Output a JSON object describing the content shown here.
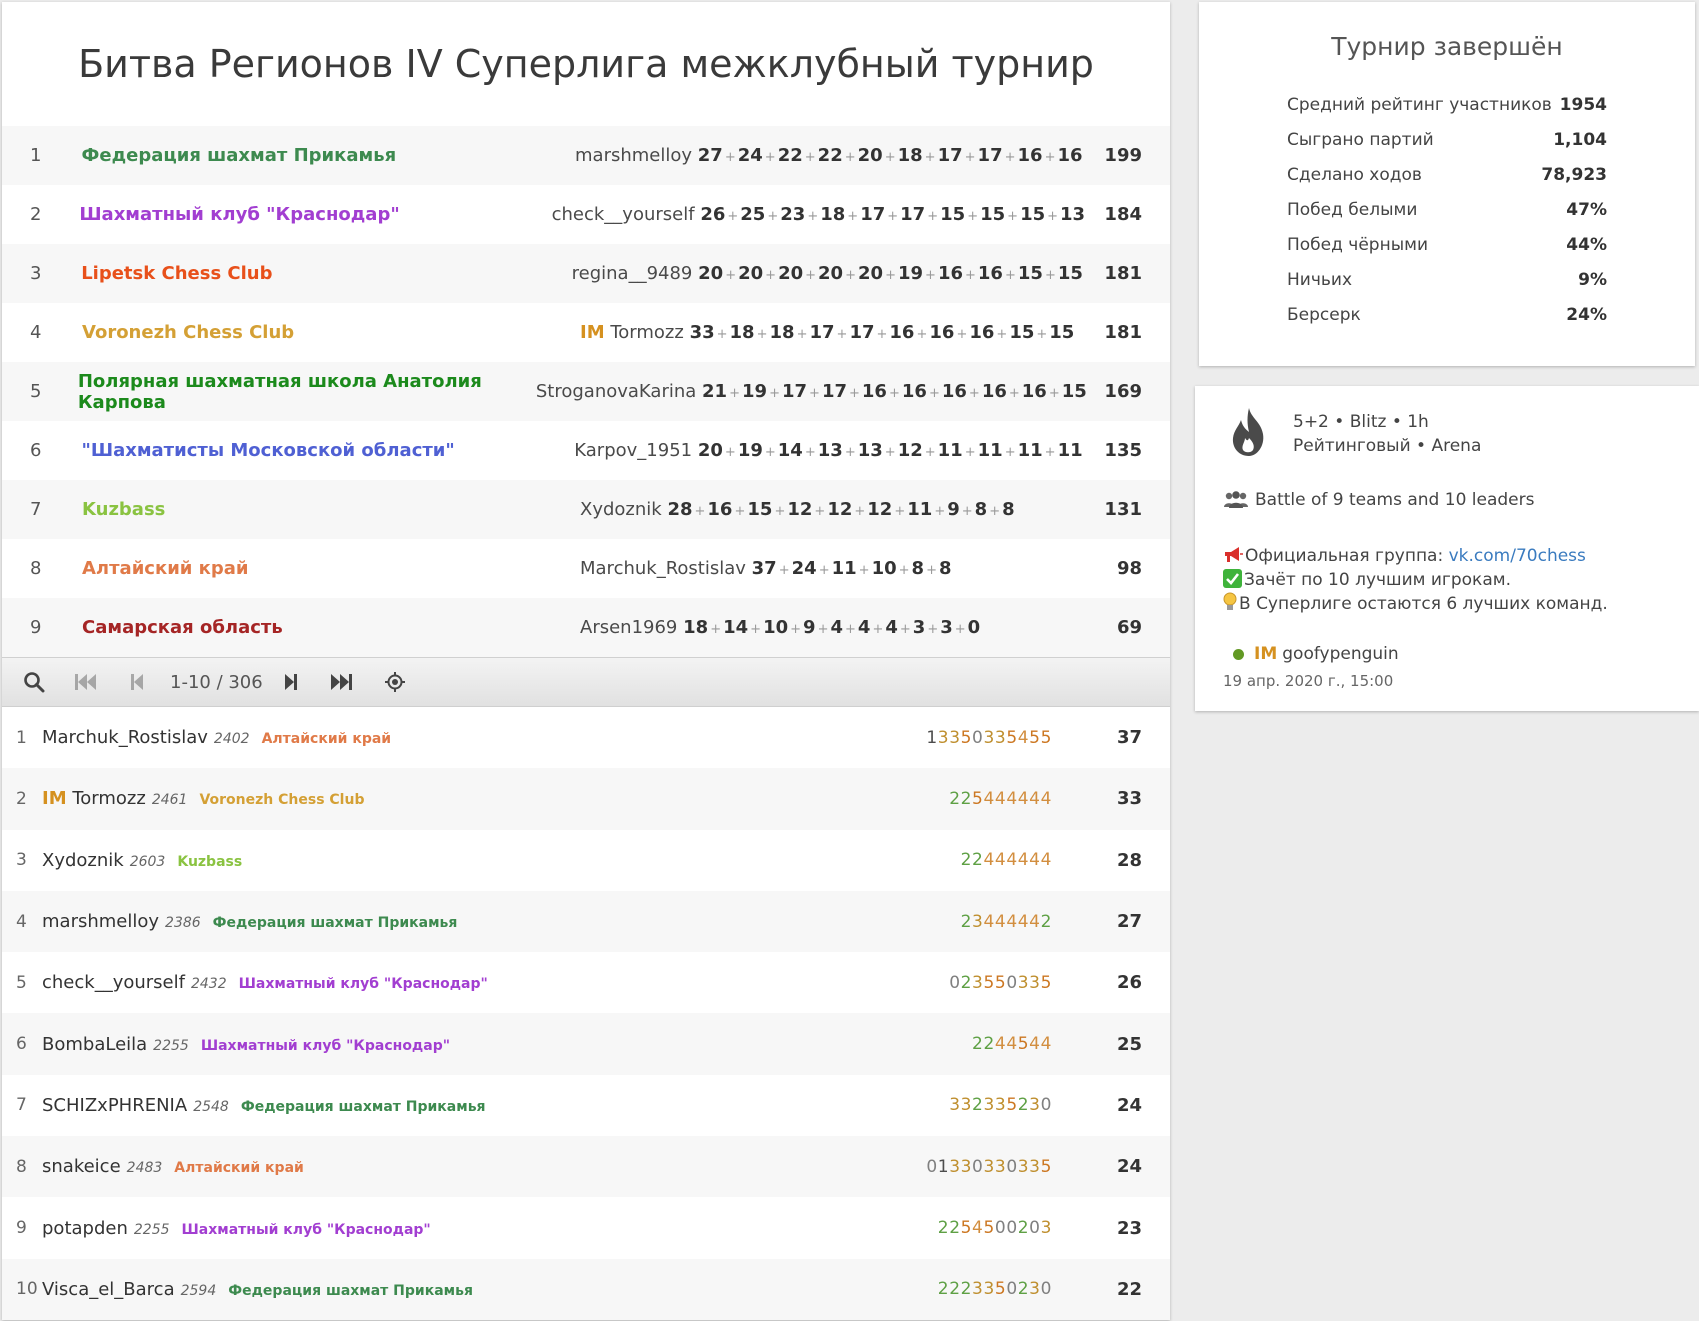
{
  "tournament": {
    "title": "Битва Регионов IV Суперлига межклубный турнир"
  },
  "colors": {
    "perm": "#3d8a4f",
    "krasnodar": "#a23ed1",
    "lipetsk": "#e8501a",
    "voronezh": "#d4a035",
    "karpov": "#1c8a1c",
    "moscow": "#4f60d3",
    "kuzbass": "#8ac341",
    "altai": "#e07a48",
    "samara": "#a52525"
  },
  "teams": [
    {
      "rank": "1",
      "name": "Федерация шахмат Прикамья",
      "color": "perm",
      "title": "",
      "leader": "marshmelloy",
      "scores": [
        "27",
        "24",
        "22",
        "22",
        "20",
        "18",
        "17",
        "17",
        "16",
        "16"
      ],
      "total": "199"
    },
    {
      "rank": "2",
      "name": "Шахматный клуб \"Краснодар\"",
      "color": "krasnodar",
      "title": "",
      "leader": "check__yourself",
      "scores": [
        "26",
        "25",
        "23",
        "18",
        "17",
        "17",
        "15",
        "15",
        "15",
        "13"
      ],
      "total": "184"
    },
    {
      "rank": "3",
      "name": "Lipetsk Chess Club",
      "color": "lipetsk",
      "title": "",
      "leader": "regina__9489",
      "scores": [
        "20",
        "20",
        "20",
        "20",
        "20",
        "19",
        "16",
        "16",
        "15",
        "15"
      ],
      "total": "181"
    },
    {
      "rank": "4",
      "name": "Voronezh Chess Club",
      "color": "voronezh",
      "title": "IM",
      "leader": "Tormozz",
      "scores": [
        "33",
        "18",
        "18",
        "17",
        "17",
        "16",
        "16",
        "16",
        "15",
        "15"
      ],
      "total": "181"
    },
    {
      "rank": "5",
      "name": "Полярная шахматная школа Анатолия Карпова",
      "color": "karpov",
      "title": "",
      "leader": "StroganovaKarina",
      "scores": [
        "21",
        "19",
        "17",
        "17",
        "16",
        "16",
        "16",
        "16",
        "16",
        "15"
      ],
      "total": "169"
    },
    {
      "rank": "6",
      "name": "\"Шахматисты Московской области\"",
      "color": "moscow",
      "title": "",
      "leader": "Karpov_1951",
      "scores": [
        "20",
        "19",
        "14",
        "13",
        "13",
        "12",
        "11",
        "11",
        "11",
        "11"
      ],
      "total": "135"
    },
    {
      "rank": "7",
      "name": "Kuzbass",
      "color": "kuzbass",
      "title": "",
      "leader": "Xydoznik",
      "scores": [
        "28",
        "16",
        "15",
        "12",
        "12",
        "12",
        "11",
        "9",
        "8",
        "8"
      ],
      "total": "131"
    },
    {
      "rank": "8",
      "name": "Алтайский край",
      "color": "altai",
      "title": "",
      "leader": "Marchuk_Rostislav",
      "scores": [
        "37",
        "24",
        "11",
        "10",
        "8",
        "8"
      ],
      "total": "98"
    },
    {
      "rank": "9",
      "name": "Самарская область",
      "color": "samara",
      "title": "",
      "leader": "Arsen1969",
      "scores": [
        "18",
        "14",
        "10",
        "9",
        "4",
        "4",
        "4",
        "3",
        "3",
        "0"
      ],
      "total": "69"
    }
  ],
  "pager": {
    "range": "1-10 / 306",
    "icons": [
      "search-icon",
      "first-page-icon",
      "prev-page-icon",
      "next-page-icon",
      "last-page-icon",
      "locate-me-icon"
    ]
  },
  "players": [
    {
      "rank": "1",
      "title": "",
      "name": "Marchuk_Rostislav",
      "rating": "2402",
      "team": "Алтайский край",
      "color": "altai",
      "sheet": "13350335455",
      "total": "37"
    },
    {
      "rank": "2",
      "title": "IM",
      "name": "Tormozz",
      "rating": "2461",
      "team": "Voronezh Chess Club",
      "color": "voronezh",
      "sheet": "225444444",
      "total": "33"
    },
    {
      "rank": "3",
      "title": "",
      "name": "Xydoznik",
      "rating": "2603",
      "team": "Kuzbass",
      "color": "kuzbass",
      "sheet": "22444444",
      "total": "28"
    },
    {
      "rank": "4",
      "title": "",
      "name": "marshmelloy",
      "rating": "2386",
      "team": "Федерация шахмат Прикамья",
      "color": "perm",
      "sheet": "23444442",
      "total": "27"
    },
    {
      "rank": "5",
      "title": "",
      "name": "check__yourself",
      "rating": "2432",
      "team": "Шахматный клуб \"Краснодар\"",
      "color": "krasnodar",
      "sheet": "023550335",
      "total": "26"
    },
    {
      "rank": "6",
      "title": "",
      "name": "BombaLeila",
      "rating": "2255",
      "team": "Шахматный клуб \"Краснодар\"",
      "color": "krasnodar",
      "sheet": "2244544",
      "total": "25"
    },
    {
      "rank": "7",
      "title": "",
      "name": "SCHIZxPHRENIA",
      "rating": "2548",
      "team": "Федерация шахмат Прикамья",
      "color": "perm",
      "sheet": "332335230",
      "total": "24"
    },
    {
      "rank": "8",
      "title": "",
      "name": "snakeice",
      "rating": "2483",
      "team": "Алтайский край",
      "color": "altai",
      "sheet": "01330330335",
      "total": "24"
    },
    {
      "rank": "9",
      "title": "",
      "name": "potapden",
      "rating": "2255",
      "team": "Шахматный клуб \"Краснодар\"",
      "color": "krasnodar",
      "sheet": "2254500203",
      "total": "23"
    },
    {
      "rank": "10",
      "title": "",
      "name": "Visca_el_Barca",
      "rating": "2594",
      "team": "Федерация шахмат Прикамья",
      "color": "perm",
      "sheet": "2223350230",
      "total": "22"
    }
  ],
  "stats": {
    "title": "Турнир завершён",
    "rows": [
      {
        "label": "Средний рейтинг участников",
        "value": "1954"
      },
      {
        "label": "Сыграно партий",
        "value": "1,104"
      },
      {
        "label": "Сделано ходов",
        "value": "78,923"
      },
      {
        "label": "Побед белыми",
        "value": "47%"
      },
      {
        "label": "Побед чёрными",
        "value": "44%"
      },
      {
        "label": "Ничьих",
        "value": "9%"
      },
      {
        "label": "Берсерк",
        "value": "24%"
      }
    ]
  },
  "info": {
    "icon": "fire-icon",
    "time_control": "5+2 • Blitz • 1h",
    "mode": "Рейтинговый • Arena",
    "teams_icon": "group-icon",
    "teams_line": "Battle of 9 teams and 10 leaders",
    "group_label": "Официальная группа: ",
    "group_link": "vk.com/70chess",
    "line2": "Зачёт по 10 лучшим игрокам.",
    "line3": "В Суперлиге остаются 6 лучших команд.",
    "creator_title": "IM",
    "creator": "goofypenguin",
    "date": "19 апр. 2020 г., 15:00"
  }
}
